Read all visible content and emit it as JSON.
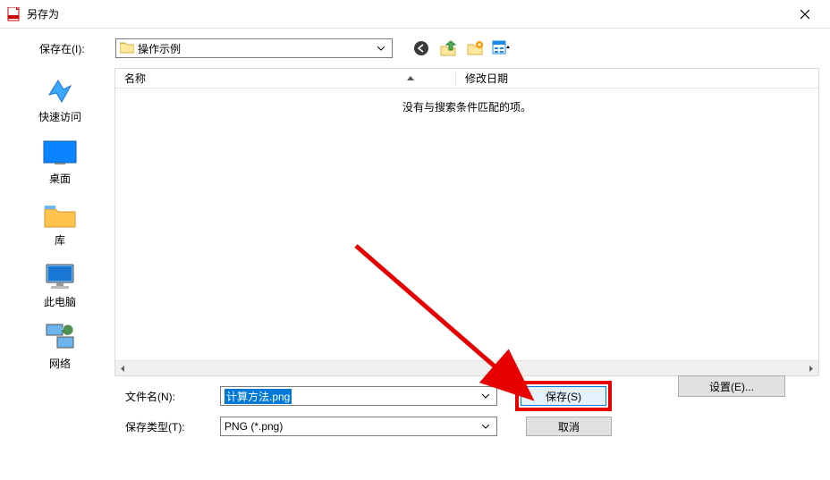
{
  "title": "另存为",
  "toprow": {
    "label": "保存在(I):",
    "location": "操作示例"
  },
  "columns": {
    "name": "名称",
    "date": "修改日期"
  },
  "empty_msg": "没有与搜索条件匹配的项。",
  "places": {
    "quick": "快速访问",
    "desktop": "桌面",
    "libraries": "库",
    "pc": "此电脑",
    "network": "网络"
  },
  "form": {
    "filename_label": "文件名(N):",
    "filename_value": "计算方法.png",
    "type_label": "保存类型(T):",
    "type_value": "PNG (*.png)",
    "save_btn": "保存(S)",
    "cancel_btn": "取消",
    "settings_btn": "设置(E)..."
  }
}
